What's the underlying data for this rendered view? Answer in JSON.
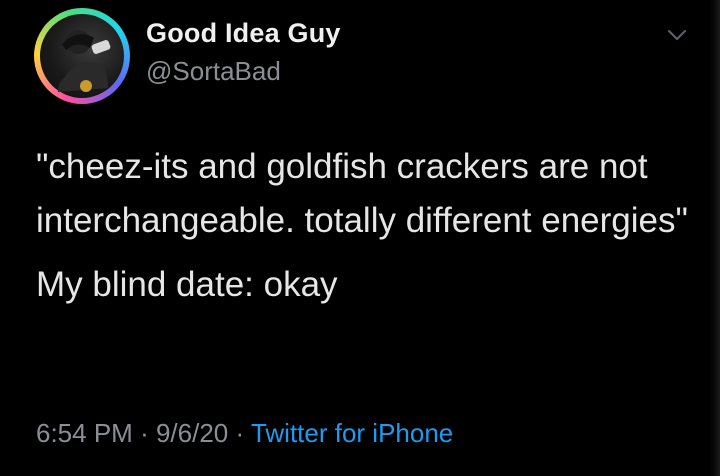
{
  "author": {
    "display_name": "Good Idea Guy",
    "handle": "@SortaBad",
    "avatar_icon": "profile-avatar"
  },
  "tweet": {
    "quote": "\"cheez-its and goldfish crackers are not interchangeable. totally different energies\"",
    "reply": "My blind date: okay"
  },
  "meta": {
    "time": "6:54 PM",
    "separator": "·",
    "date": "9/6/20",
    "source": "Twitter for iPhone"
  },
  "menu_icon": "chevron-down-icon",
  "colors": {
    "background": "#000000",
    "text": "#e6e6e6",
    "muted": "#8b8f95",
    "link": "#1d9bf0"
  }
}
